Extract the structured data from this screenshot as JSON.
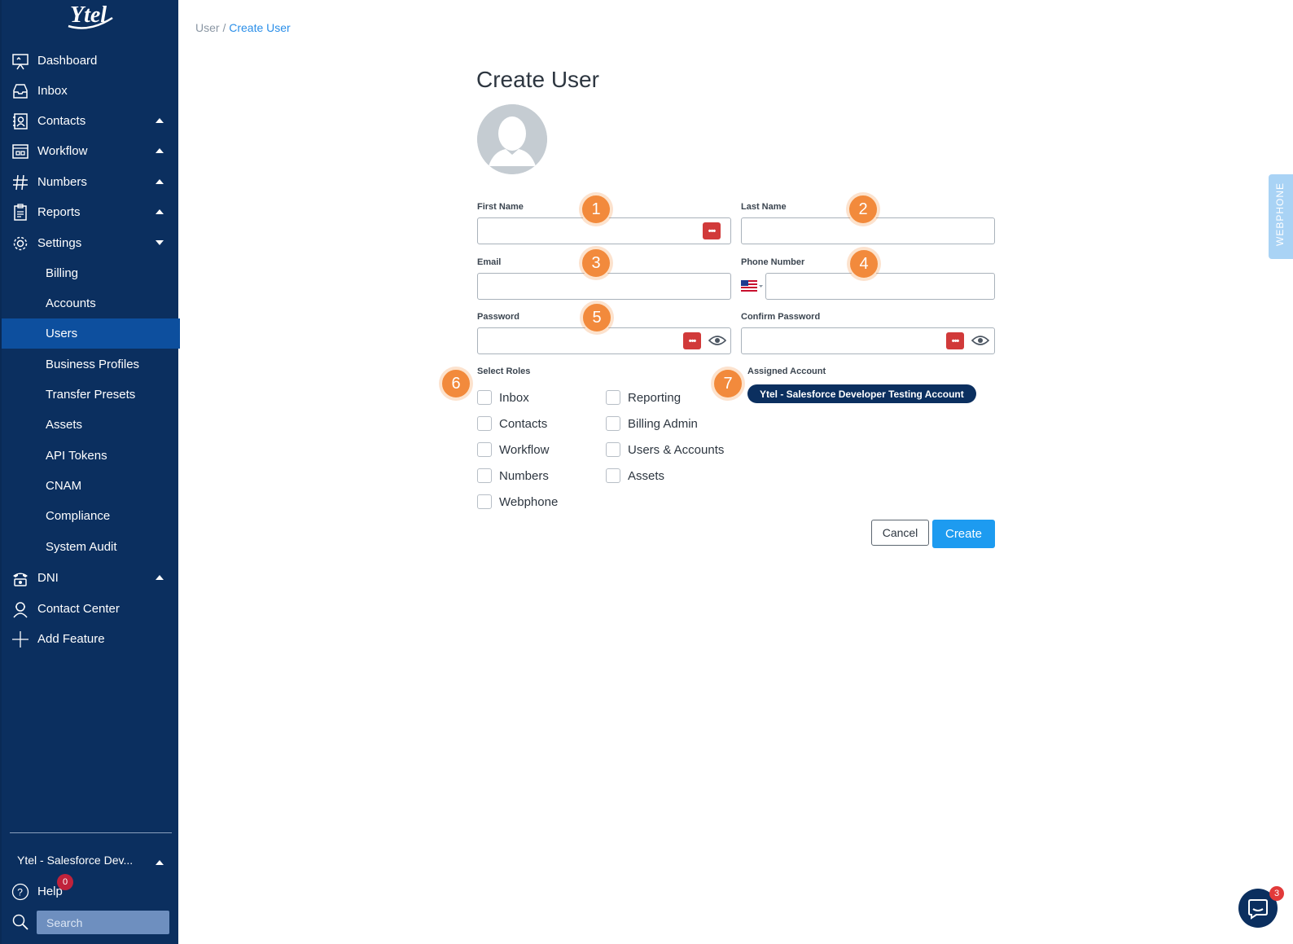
{
  "sidebar": {
    "logo_text": "Ytel",
    "items": [
      {
        "label": "Dashboard",
        "icon": "dashboard-icon"
      },
      {
        "label": "Inbox",
        "icon": "inbox-icon"
      },
      {
        "label": "Contacts",
        "icon": "contacts-icon",
        "expanded": false
      },
      {
        "label": "Workflow",
        "icon": "workflow-icon",
        "expanded": false
      },
      {
        "label": "Numbers",
        "icon": "hash-icon",
        "expanded": false
      },
      {
        "label": "Reports",
        "icon": "reports-icon",
        "expanded": false
      },
      {
        "label": "Settings",
        "icon": "gear-icon",
        "expanded": true
      }
    ],
    "settings_sub": [
      "Billing",
      "Accounts",
      "Users",
      "Business Profiles",
      "Transfer Presets",
      "Assets",
      "API Tokens",
      "CNAM",
      "Compliance",
      "System Audit"
    ],
    "active_sub": "Users",
    "bottom_items": [
      {
        "label": "DNI",
        "icon": "phone-icon",
        "expanded": false
      },
      {
        "label": "Contact Center",
        "icon": "agent-icon"
      },
      {
        "label": "Add Feature",
        "icon": "plus-icon"
      }
    ],
    "account_name": "Ytel - Salesforce Dev...",
    "help_label": "Help",
    "help_badge": "0",
    "search_placeholder": "Search"
  },
  "breadcrumb": {
    "parent": "User",
    "separator": " / ",
    "current": "Create User"
  },
  "form": {
    "title": "Create User",
    "first_name_label": "First Name",
    "last_name_label": "Last Name",
    "email_label": "Email",
    "phone_label": "Phone Number",
    "password_label": "Password",
    "confirm_password_label": "Confirm Password",
    "pw_manager_glyph": "•••",
    "select_roles_label": "Select Roles",
    "roles_col1": [
      "Inbox",
      "Contacts",
      "Workflow",
      "Numbers",
      "Webphone"
    ],
    "roles_col2": [
      "Reporting",
      "Billing Admin",
      "Users & Accounts",
      "Assets"
    ],
    "assigned_account_label": "Assigned Account",
    "assigned_account": "Ytel - Salesforce Developer Testing Account",
    "cancel_label": "Cancel",
    "create_label": "Create"
  },
  "steps": [
    "1",
    "2",
    "3",
    "4",
    "5",
    "6",
    "7"
  ],
  "webphone_tab": "WEBPHONE",
  "chat_badge": "3",
  "colors": {
    "sidebar": "#0b2f5f",
    "active": "#0d4f9e",
    "accent": "#1d9bf0",
    "step": "#f28a3c"
  }
}
